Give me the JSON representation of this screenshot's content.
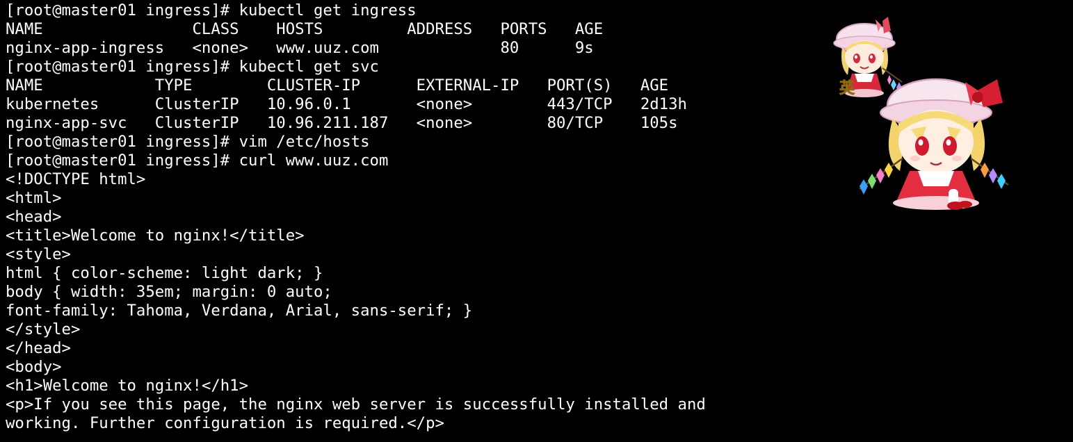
{
  "terminal": {
    "lines": [
      "[root@master01 ingress]# kubectl get ingress",
      "NAME                CLASS    HOSTS         ADDRESS   PORTS   AGE",
      "nginx-app-ingress   <none>   www.uuz.com             80      9s",
      "[root@master01 ingress]# kubectl get svc",
      "NAME            TYPE        CLUSTER-IP      EXTERNAL-IP   PORT(S)   AGE",
      "kubernetes      ClusterIP   10.96.0.1       <none>        443/TCP   2d13h",
      "nginx-app-svc   ClusterIP   10.96.211.187   <none>        80/TCP    105s",
      "[root@master01 ingress]# vim /etc/hosts",
      "[root@master01 ingress]# curl www.uuz.com",
      "<!DOCTYPE html>",
      "<html>",
      "<head>",
      "<title>Welcome to nginx!</title>",
      "<style>",
      "html { color-scheme: light dark; }",
      "body { width: 35em; margin: 0 auto;",
      "font-family: Tahoma, Verdana, Arial, sans-serif; }",
      "</style>",
      "</head>",
      "<body>",
      "<h1>Welcome to nginx!</h1>",
      "<p>If you see this page, the nginx web server is successfully installed and",
      "working. Further configuration is required.</p>"
    ]
  },
  "mascot": {
    "badge_text": "英"
  },
  "colors": {
    "background": "#000000",
    "text": "#ffffff"
  }
}
